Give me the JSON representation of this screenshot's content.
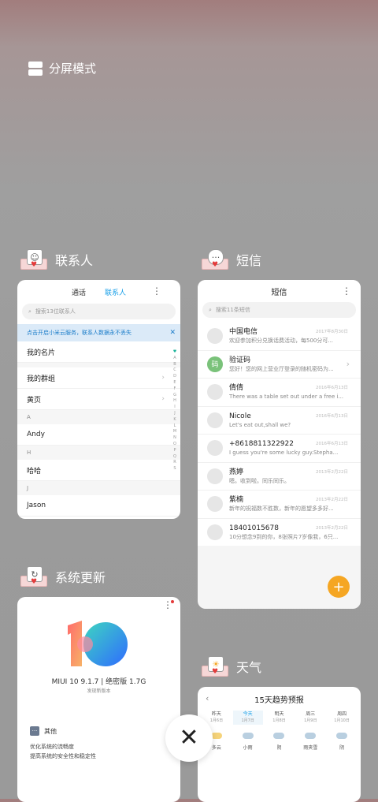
{
  "split_screen": {
    "label": "分屏模式"
  },
  "contacts": {
    "app_label": "联系人",
    "tabs": [
      "通话",
      "联系人"
    ],
    "search_placeholder": "搜索13位联系人",
    "banner_text": "点击开启小米云服务，联系人数据永不丢失",
    "rows": {
      "my_card": "我的名片",
      "my_groups": "我的群组",
      "yellow_pages": "黄页"
    },
    "section_a": "A",
    "andy": "Andy",
    "section_h": "H",
    "haha": "哈哈",
    "section_j": "J",
    "jason": "Jason",
    "alphabet": [
      "A",
      "B",
      "C",
      "D",
      "E",
      "F",
      "G",
      "H",
      "I",
      "J",
      "K",
      "L",
      "M",
      "N",
      "O",
      "P",
      "Q",
      "R",
      "S"
    ]
  },
  "messages": {
    "app_label": "短信",
    "title": "短信",
    "search_placeholder": "搜索11条短信",
    "items": [
      {
        "name": "中国电信",
        "snippet": "欢迎参加积分兑换话费活动，每500分可...",
        "time": "2017年8月30日"
      },
      {
        "name": "验证码",
        "snippet": "您好！您的网上营业厅登录的随机密码为...",
        "time": ""
      },
      {
        "name": "倩倩",
        "snippet": "There was a table set out under a free i...",
        "time": "2016年6月13日"
      },
      {
        "name": "Nicole",
        "snippet": "Let's eat out,shall we?",
        "time": "2016年6月13日"
      },
      {
        "name": "+8618811322922",
        "snippet": "I guess you're some lucky guy.Stepha...",
        "time": "2016年6月13日"
      },
      {
        "name": "燕婷",
        "snippet": "嗯。收到啦。同乐同乐。",
        "time": "2013年2月22日"
      },
      {
        "name": "紫楠",
        "snippet": "新年的祝福数不胜数，新年的愿望多多好...",
        "time": "2013年2月22日"
      },
      {
        "name": "18401015678",
        "snippet": "10分想念9到的你，8张照片7岁像我，6只...",
        "time": "2013年2月22日"
      }
    ],
    "verify_avatar": "码",
    "fab": "+"
  },
  "system_update": {
    "app_label": "系统更新",
    "version": "MIUI 10 9.1.7 | 绝密版 1.7G",
    "subtitle": "发现新版本",
    "section_title": "其他",
    "notes": [
      "优化系统的流畅度",
      "提高系统的安全性和稳定性"
    ]
  },
  "weather": {
    "app_label": "天气",
    "title": "15天趋势预报",
    "days": [
      {
        "name": "昨天",
        "date": "1月6日"
      },
      {
        "name": "今天",
        "date": "1月7日"
      },
      {
        "name": "明天",
        "date": "1月8日"
      },
      {
        "name": "周三",
        "date": "1月9日"
      },
      {
        "name": "周四",
        "date": "1月10日"
      }
    ],
    "conditions": [
      "多云",
      "小雨",
      "阴",
      "雨夹雪",
      "阴"
    ]
  },
  "close_label": "✕"
}
